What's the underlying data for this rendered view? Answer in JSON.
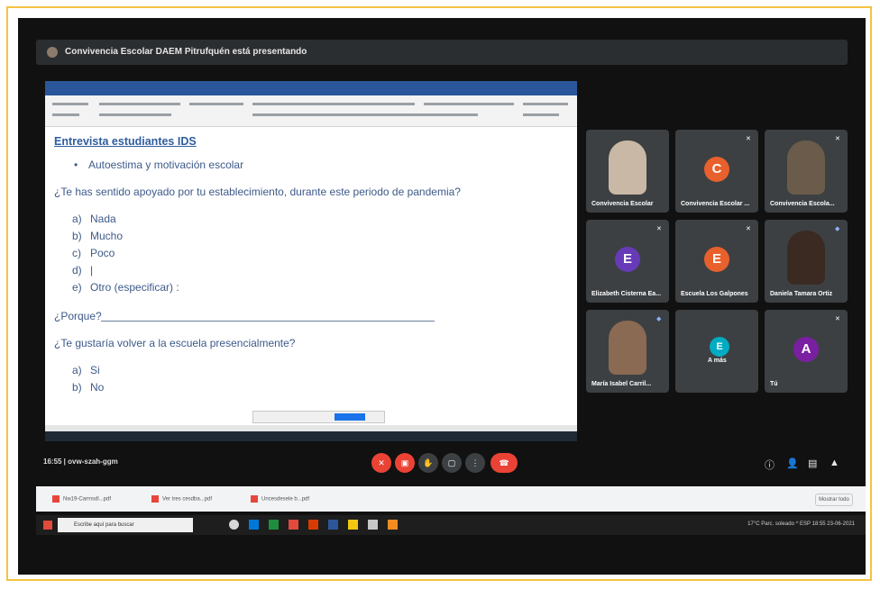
{
  "meet": {
    "presenting_text": "Convivencia Escolar DAEM Pitrufquén está presentando",
    "meeting_code": "16:55  |  ovw-szah-ggm"
  },
  "document": {
    "title": "Entrevista estudiantes IDS",
    "bullet": "Autoestima y motivación escolar",
    "q1": "¿Te has sentido apoyado por tu establecimiento, durante este periodo de pandemia?",
    "options1": [
      {
        "letter": "a)",
        "text": "Nada"
      },
      {
        "letter": "b)",
        "text": "Mucho"
      },
      {
        "letter": "c)",
        "text": "Poco"
      },
      {
        "letter": "d)",
        "text": "|"
      },
      {
        "letter": "e)",
        "text": "Otro (especificar)     :"
      }
    ],
    "porque": "¿Porque?",
    "q2": "¿Te gustaría volver a la escuela presencialmente?",
    "options2": [
      {
        "letter": "a)",
        "text": "Si"
      },
      {
        "letter": "b)",
        "text": "No"
      }
    ]
  },
  "participants": [
    {
      "name": "Convivencia Escolar",
      "initial": "",
      "video": true,
      "color": "#c9b8a6"
    },
    {
      "name": "Convivencia Escolar ...",
      "initial": "C",
      "video": false,
      "color": "#e8602c"
    },
    {
      "name": "Convivencia Escola...",
      "initial": "",
      "video": true,
      "color": "#6b5b4b"
    },
    {
      "name": "Elizabeth Cisterna Ea...",
      "initial": "E",
      "video": false,
      "color": "#673ab7"
    },
    {
      "name": "Escuela Los Galpones",
      "initial": "E",
      "video": false,
      "color": "#e8602c"
    },
    {
      "name": "Daniela Tamara Ortiz",
      "initial": "",
      "video": true,
      "color": "#3a2a22"
    },
    {
      "name": "María Isabel Carril...",
      "initial": "",
      "video": true,
      "color": "#8a6a52"
    },
    {
      "name": "A más",
      "initial": "E",
      "video": false,
      "color": "#00acc1"
    },
    {
      "name": "Tú",
      "initial": "A",
      "video": false,
      "color": "#7b1fa2"
    }
  ],
  "downloads": {
    "files": [
      "Nw19-Carmsdl...pdf",
      "Ver tres cesdba...pdf",
      "Uncesdesele b...pdf"
    ],
    "show_all": "Mostrar todo"
  },
  "taskbar": {
    "search_placeholder": "Escribe aquí para buscar",
    "tray_text": "17°C  Parc. soleado   ^  ESP  18:55  23-06-2021"
  },
  "colors": {
    "accent_red": "#ea4335",
    "meet_dark": "#3c4043",
    "frame_border": "#f4c342"
  }
}
